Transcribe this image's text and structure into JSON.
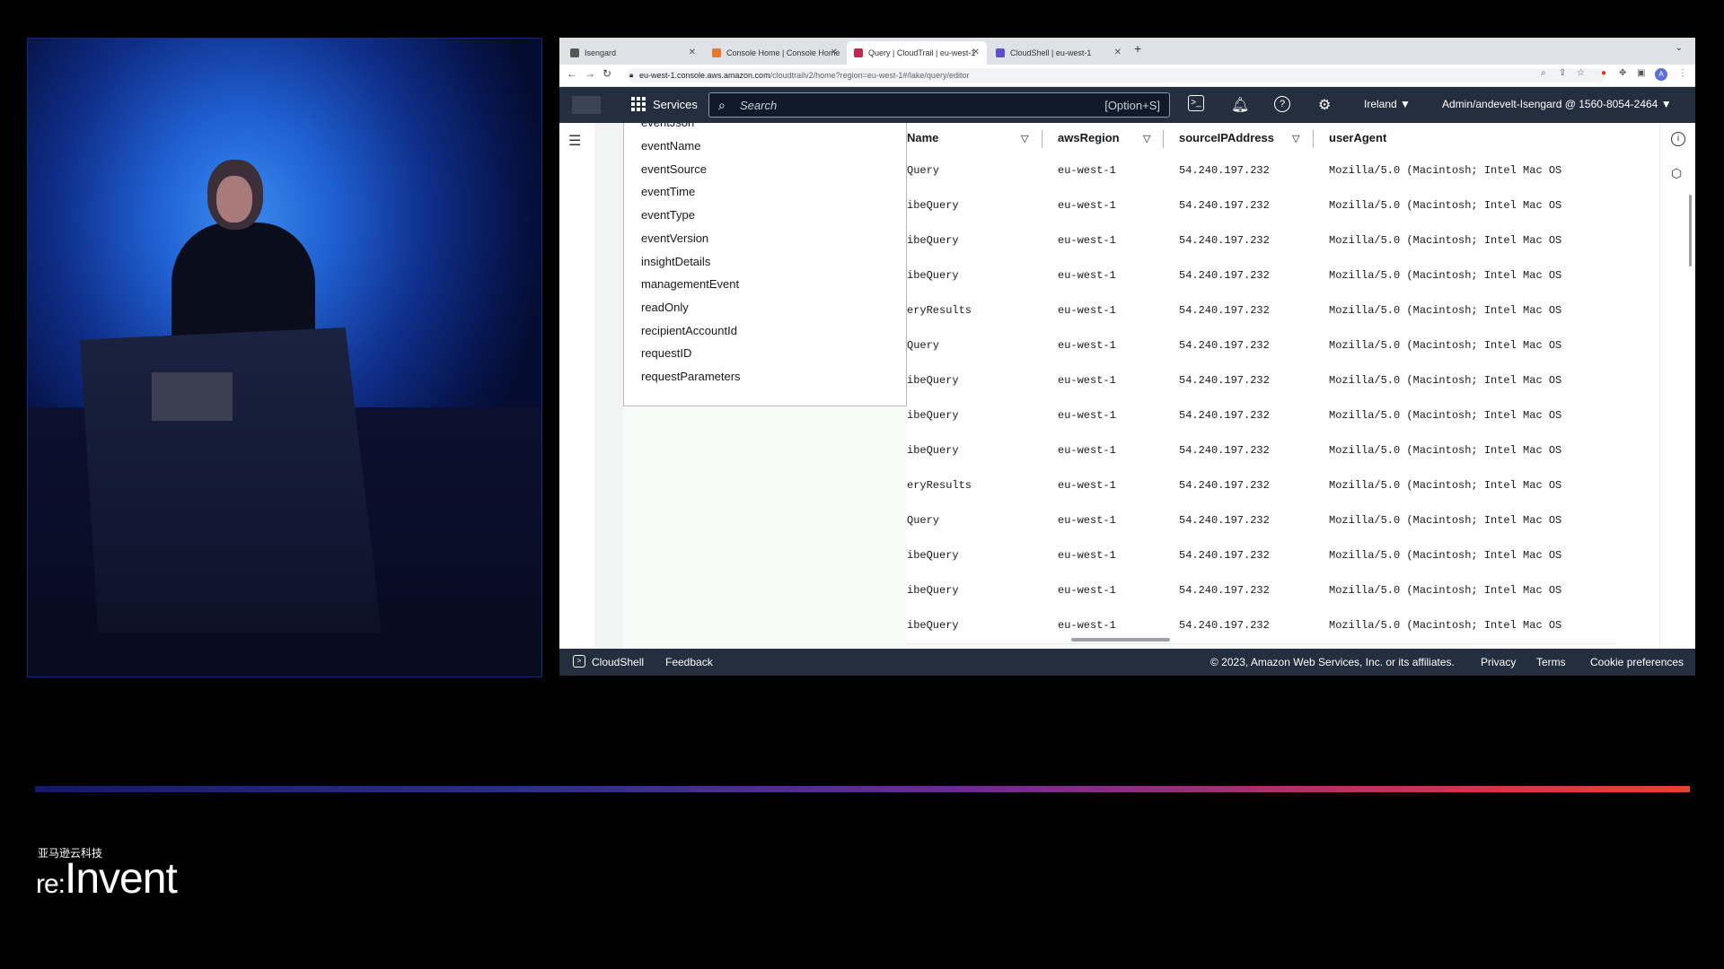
{
  "browser": {
    "tabs": [
      {
        "title": "Isengard",
        "active": false,
        "color": "#555555"
      },
      {
        "title": "Console Home | Console Home",
        "active": false,
        "color": "#e8762c"
      },
      {
        "title": "Query | CloudTrail | eu-west-1",
        "active": true,
        "color": "#c7254e"
      },
      {
        "title": "CloudShell | eu-west-1",
        "active": false,
        "color": "#5a4fcf"
      }
    ],
    "url_host": "eu-west-1.console.aws.amazon.com",
    "url_path": "/cloudtrailv2/home?region=eu-west-1#/lake/query/editor",
    "profile_initial": "A"
  },
  "aws_nav": {
    "services_label": "Services",
    "search_placeholder": "Search",
    "search_shortcut": "[Option+S]",
    "region": "Ireland",
    "account": "Admin/andevelt-Isengard @ 1560-8054-2464"
  },
  "field_list": {
    "partial_top": "eventJson",
    "items": [
      "eventName",
      "eventSource",
      "eventTime",
      "eventType",
      "eventVersion",
      "insightDetails",
      "managementEvent",
      "readOnly",
      "recipientAccountId",
      "requestID",
      "requestParameters"
    ]
  },
  "table": {
    "columns": [
      "Name",
      "awsRegion",
      "sourceIPAddress",
      "userAgent"
    ],
    "rows": [
      [
        "Query",
        "eu-west-1",
        "54.240.197.232",
        "Mozilla/5.0 (Macintosh; Intel Mac OS"
      ],
      [
        "ibeQuery",
        "eu-west-1",
        "54.240.197.232",
        "Mozilla/5.0 (Macintosh; Intel Mac OS"
      ],
      [
        "ibeQuery",
        "eu-west-1",
        "54.240.197.232",
        "Mozilla/5.0 (Macintosh; Intel Mac OS"
      ],
      [
        "ibeQuery",
        "eu-west-1",
        "54.240.197.232",
        "Mozilla/5.0 (Macintosh; Intel Mac OS"
      ],
      [
        "eryResults",
        "eu-west-1",
        "54.240.197.232",
        "Mozilla/5.0 (Macintosh; Intel Mac OS"
      ],
      [
        "Query",
        "eu-west-1",
        "54.240.197.232",
        "Mozilla/5.0 (Macintosh; Intel Mac OS"
      ],
      [
        "ibeQuery",
        "eu-west-1",
        "54.240.197.232",
        "Mozilla/5.0 (Macintosh; Intel Mac OS"
      ],
      [
        "ibeQuery",
        "eu-west-1",
        "54.240.197.232",
        "Mozilla/5.0 (Macintosh; Intel Mac OS"
      ],
      [
        "ibeQuery",
        "eu-west-1",
        "54.240.197.232",
        "Mozilla/5.0 (Macintosh; Intel Mac OS"
      ],
      [
        "eryResults",
        "eu-west-1",
        "54.240.197.232",
        "Mozilla/5.0 (Macintosh; Intel Mac OS"
      ],
      [
        "Query",
        "eu-west-1",
        "54.240.197.232",
        "Mozilla/5.0 (Macintosh; Intel Mac OS"
      ],
      [
        "ibeQuery",
        "eu-west-1",
        "54.240.197.232",
        "Mozilla/5.0 (Macintosh; Intel Mac OS"
      ],
      [
        "ibeQuery",
        "eu-west-1",
        "54.240.197.232",
        "Mozilla/5.0 (Macintosh; Intel Mac OS"
      ],
      [
        "ibeQuery",
        "eu-west-1",
        "54.240.197.232",
        "Mozilla/5.0 (Macintosh; Intel Mac OS"
      ]
    ]
  },
  "footer": {
    "cloudshell": "CloudShell",
    "feedback": "Feedback",
    "copyright": "© 2023, Amazon Web Services, Inc. or its affiliates.",
    "privacy": "Privacy",
    "terms": "Terms",
    "cookies": "Cookie preferences"
  },
  "event": {
    "brand_cn": "亚马逊云科技",
    "brand_prefix": "re:",
    "brand_name": "Invent"
  },
  "colors": {
    "aws_nav_bg": "#232f3e",
    "accent_gradient_start": "#141a6a",
    "accent_gradient_end": "#e2442e"
  }
}
